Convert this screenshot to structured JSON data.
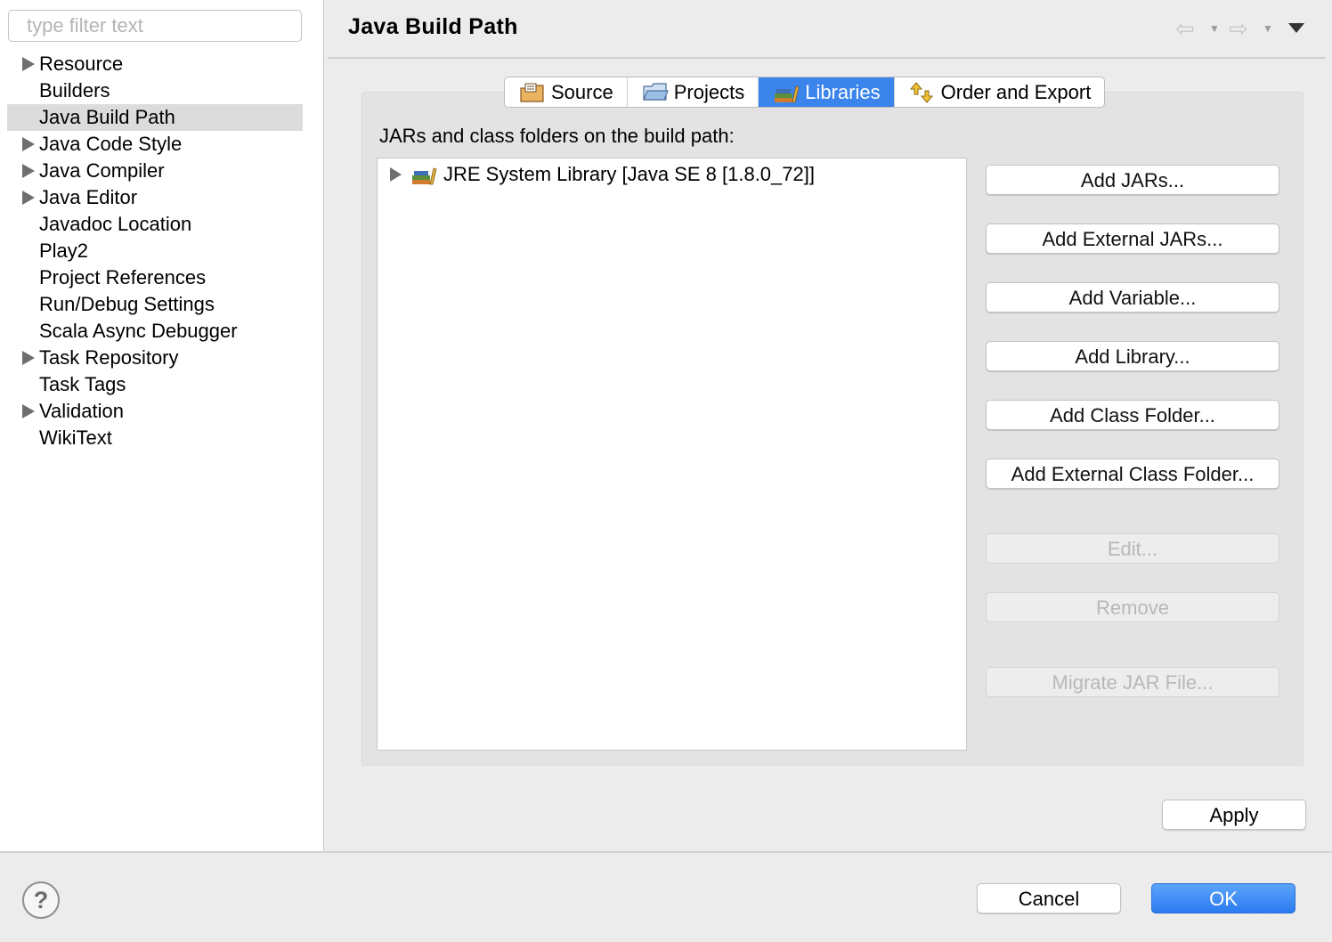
{
  "sidebar": {
    "filter_placeholder": "type filter text",
    "items": [
      {
        "label": "Resource",
        "expandable": true
      },
      {
        "label": "Builders",
        "expandable": false
      },
      {
        "label": "Java Build Path",
        "expandable": false,
        "selected": true
      },
      {
        "label": "Java Code Style",
        "expandable": true
      },
      {
        "label": "Java Compiler",
        "expandable": true
      },
      {
        "label": "Java Editor",
        "expandable": true
      },
      {
        "label": "Javadoc Location",
        "expandable": false
      },
      {
        "label": "Play2",
        "expandable": false
      },
      {
        "label": "Project References",
        "expandable": false
      },
      {
        "label": "Run/Debug Settings",
        "expandable": false
      },
      {
        "label": "Scala Async Debugger",
        "expandable": false
      },
      {
        "label": "Task Repository",
        "expandable": true
      },
      {
        "label": "Task Tags",
        "expandable": false
      },
      {
        "label": "Validation",
        "expandable": true
      },
      {
        "label": "WikiText",
        "expandable": false
      }
    ]
  },
  "header": {
    "title": "Java Build Path",
    "back_icon": "back-arrow-icon",
    "forward_icon": "forward-arrow-icon",
    "menu_icon": "view-menu-icon"
  },
  "tabs": [
    {
      "label": "Source",
      "icon": "source-folder-icon"
    },
    {
      "label": "Projects",
      "icon": "projects-folder-icon"
    },
    {
      "label": "Libraries",
      "icon": "libraries-icon",
      "active": true
    },
    {
      "label": "Order and Export",
      "icon": "order-export-icon"
    }
  ],
  "libraries": {
    "list_label": "JARs and class folders on the build path:",
    "entries": [
      {
        "label": "JRE System Library [Java SE 8 [1.8.0_72]]",
        "icon": "library-icon",
        "expandable": true
      }
    ]
  },
  "buttons": {
    "add_jars": "Add JARs...",
    "add_external_jars": "Add External JARs...",
    "add_variable": "Add Variable...",
    "add_library": "Add Library...",
    "add_class_folder": "Add Class Folder...",
    "add_external_class_folder": "Add External Class Folder...",
    "edit": "Edit...",
    "remove": "Remove",
    "migrate_jar": "Migrate JAR File...",
    "apply": "Apply"
  },
  "footer": {
    "help_icon": "help-icon",
    "help_glyph": "?",
    "cancel": "Cancel",
    "ok": "OK"
  },
  "colors": {
    "accent": "#3a84ec",
    "selection": "#dcdcdc",
    "panel": "#e3e3e3",
    "background": "#ececec"
  }
}
